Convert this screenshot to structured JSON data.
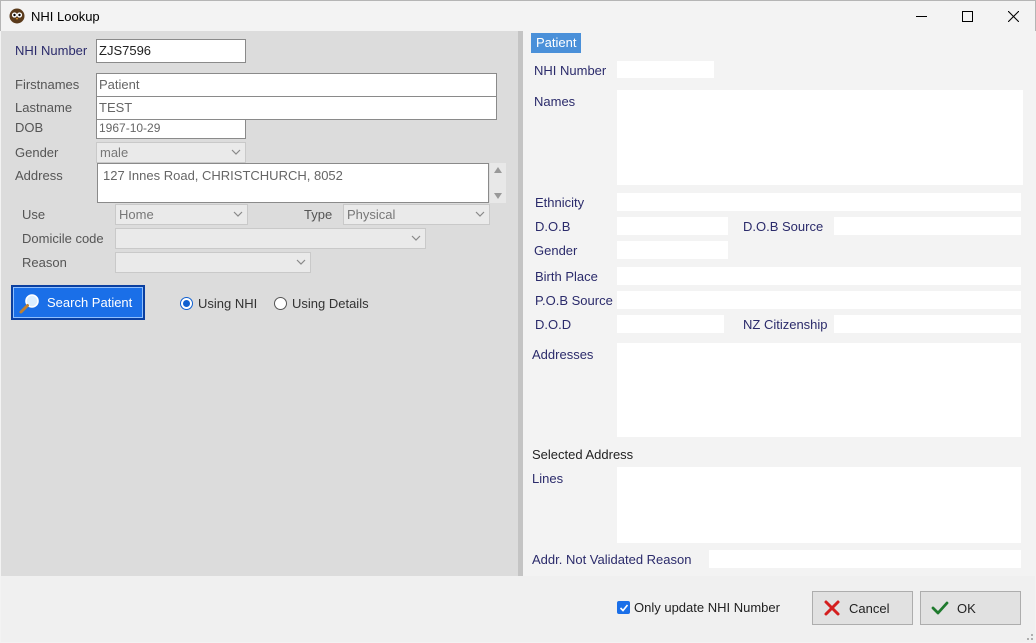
{
  "window": {
    "title": "NHI Lookup",
    "icon": "owl-app-icon"
  },
  "left": {
    "nhi_label": "NHI Number",
    "nhi_value": "ZJS7596",
    "firstnames_label": "Firstnames",
    "firstnames_value": "Patient",
    "lastname_label": "Lastname",
    "lastname_value": "TEST",
    "dob_label": "DOB",
    "dob_value": "1967-10-29",
    "gender_label": "Gender",
    "gender_value": "male",
    "address_label": "Address",
    "address_value": "127 Innes Road, CHRISTCHURCH, 8052",
    "use_label": "Use",
    "use_value": "Home",
    "type_label": "Type",
    "type_value": "Physical",
    "domicile_label": "Domicile code",
    "domicile_value": "",
    "reason_label": "Reason",
    "reason_value": "",
    "search_button": "Search Patient",
    "radio_nhi": "Using  NHI",
    "radio_details": "Using Details",
    "radio_selected": "nhi"
  },
  "right": {
    "tab": "Patient",
    "nhi_label": "NHI Number",
    "names_label": "Names",
    "ethnicity_label": "Ethnicity",
    "dob_label": "D.O.B",
    "dob_source_label": "D.O.B Source",
    "gender_label": "Gender",
    "birth_place_label": "Birth Place",
    "pob_source_label": "P.O.B Source",
    "dod_label": "D.O.D",
    "nz_citizenship_label": "NZ Citizenship",
    "addresses_label": "Addresses",
    "selected_address_label": "Selected Address",
    "lines_label": "Lines",
    "addr_not_validated_label": "Addr. Not Validated Reason"
  },
  "footer": {
    "only_update_label": "Only update NHI Number",
    "only_update_checked": true,
    "cancel_label": "Cancel",
    "ok_label": "OK"
  },
  "colors": {
    "accent": "#1a6fe8",
    "label_blue": "#2b2b6b",
    "panel_grey": "#dcdcdc",
    "tab_blue": "#4a90d9"
  }
}
